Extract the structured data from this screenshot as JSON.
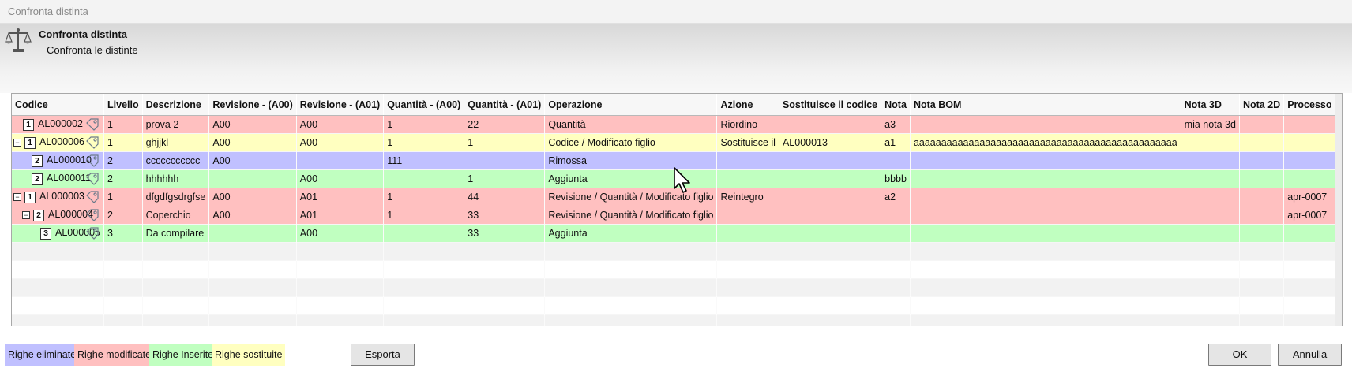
{
  "window": {
    "title": "Confronta distinta"
  },
  "header": {
    "title": "Confronta distinta",
    "subtitle": "Confronta le distinte",
    "icon": "scales-icon"
  },
  "table": {
    "columns": [
      "Codice",
      "Livello",
      "Descrizione",
      "Revisione - (A00)",
      "Revisione - (A01)",
      "Quantità - (A00)",
      "Quantità - (A01)",
      "Operazione",
      "Azione",
      "Sostituisce il codice",
      "Nota",
      "Nota BOM",
      "Nota 3D",
      "Nota 2D",
      "Processo"
    ],
    "rows": [
      {
        "status": "modified",
        "indent": 0,
        "expander": "",
        "level": "1",
        "code": "AL000002",
        "livello": "1",
        "descrizione": "prova 2",
        "rev_a00": "A00",
        "rev_a01": "A00",
        "qta_a00": "1",
        "qta_a01": "22",
        "operazione": "Quantità",
        "azione": "Riordino",
        "sostituisce": "",
        "nota": "a3",
        "nota_bom": "",
        "nota_3d": "mia nota 3d",
        "nota_2d": "",
        "processo": ""
      },
      {
        "status": "replaced",
        "indent": 0,
        "expander": "−",
        "level": "1",
        "code": "AL000006",
        "livello": "1",
        "descrizione": "ghjjkl",
        "rev_a00": "A00",
        "rev_a01": "A00",
        "qta_a00": "1",
        "qta_a01": "1",
        "operazione": "Codice / Modificato figlio",
        "azione": "Sostituisce il",
        "sostituisce": "AL000013",
        "nota": "a1",
        "nota_bom": "aaaaaaaaaaaaaaaaaaaaaaaaaaaaaaaaaaaaaaaaaaaaaaaa",
        "nota_3d": "",
        "nota_2d": "",
        "processo": ""
      },
      {
        "status": "removed",
        "indent": 1,
        "expander": "",
        "level": "2",
        "code": "AL000010",
        "livello": "2",
        "descrizione": "ccccccccccc",
        "rev_a00": "A00",
        "rev_a01": "",
        "qta_a00": "111",
        "qta_a01": "",
        "operazione": "Rimossa",
        "azione": "",
        "sostituisce": "",
        "nota": "",
        "nota_bom": "",
        "nota_3d": "",
        "nota_2d": "",
        "processo": ""
      },
      {
        "status": "added",
        "indent": 1,
        "expander": "",
        "level": "2",
        "code": "AL000011",
        "livello": "2",
        "descrizione": "hhhhhh",
        "rev_a00": "",
        "rev_a01": "A00",
        "qta_a00": "",
        "qta_a01": "1",
        "operazione": "Aggiunta",
        "azione": "",
        "sostituisce": "",
        "nota": "bbbb",
        "nota_bom": "",
        "nota_3d": "",
        "nota_2d": "",
        "processo": ""
      },
      {
        "status": "modified",
        "indent": 0,
        "expander": "−",
        "level": "1",
        "code": "AL000003",
        "livello": "1",
        "descrizione": "dfgdfgsdrgfse",
        "rev_a00": "A00",
        "rev_a01": "A01",
        "qta_a00": "1",
        "qta_a01": "44",
        "operazione": "Revisione / Quantità / Modificato figlio",
        "azione": "Reintegro",
        "sostituisce": "",
        "nota": "a2",
        "nota_bom": "",
        "nota_3d": "",
        "nota_2d": "",
        "processo": "apr-0007"
      },
      {
        "status": "modified",
        "indent": 1,
        "expander": "−",
        "level": "2",
        "code": "AL000004",
        "livello": "2",
        "descrizione": "Coperchio",
        "rev_a00": "A00",
        "rev_a01": "A01",
        "qta_a00": "1",
        "qta_a01": "33",
        "operazione": "Revisione / Quantità / Modificato figlio",
        "azione": "",
        "sostituisce": "",
        "nota": "",
        "nota_bom": "",
        "nota_3d": "",
        "nota_2d": "",
        "processo": "apr-0007"
      },
      {
        "status": "added",
        "indent": 2,
        "expander": "",
        "level": "3",
        "code": "AL000005",
        "livello": "3",
        "descrizione": "Da compilare",
        "rev_a00": "",
        "rev_a01": "A00",
        "qta_a00": "",
        "qta_a01": "33",
        "operazione": "Aggiunta",
        "azione": "",
        "sostituisce": "",
        "nota": "",
        "nota_bom": "",
        "nota_3d": "",
        "nota_2d": "",
        "processo": ""
      }
    ],
    "empty_rows": 5
  },
  "legend": {
    "removed": "Righe eliminate",
    "modified": "Righe modificate",
    "added": "Righe Inserite",
    "replaced": "Righe sostituite"
  },
  "colors": {
    "removed": "#c0c0ff",
    "modified": "#ffc0c0",
    "added": "#c0ffc0",
    "replaced": "#ffffc0"
  },
  "buttons": {
    "export": "Esporta",
    "ok": "OK",
    "cancel": "Annulla"
  }
}
